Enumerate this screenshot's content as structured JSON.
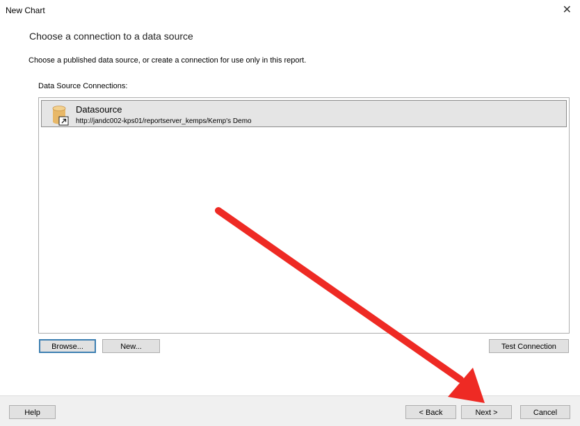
{
  "window": {
    "title": "New Chart",
    "close_label": "✕"
  },
  "page": {
    "heading": "Choose a connection to a data source",
    "description": "Choose a published data source, or create a connection for use only in this report.",
    "connections_label": "Data Source Connections:"
  },
  "connections": [
    {
      "name": "Datasource",
      "url": "http://jandc002-kps01/reportserver_kemps/Kemp's Demo",
      "icon": "database-shortcut-icon"
    }
  ],
  "buttons": {
    "browse": "Browse...",
    "new": "New...",
    "test_connection": "Test Connection",
    "help": "Help",
    "back": "< Back",
    "next": "Next >",
    "cancel": "Cancel"
  },
  "annotation": {
    "color": "#ee2a24",
    "icon": "red-arrow-pointing-to-next"
  },
  "colors": {
    "selected_item_bg": "#e5e5e5",
    "default_button_border": "#3c7fb1",
    "button_bg": "#e1e1e1",
    "footer_bg": "#f0f0f0"
  }
}
